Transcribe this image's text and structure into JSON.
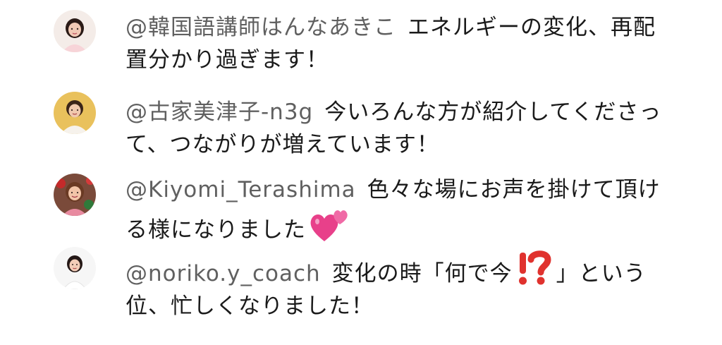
{
  "comments": [
    {
      "handle": "@韓国語講師はんなあきこ",
      "text": "エネルギーの変化、再配置分かり過ぎます！"
    },
    {
      "handle": "@古家美津子-n3g",
      "text": "今いろんな方が紹介してくださって、つながりが増えています！"
    },
    {
      "handle": "@Kiyomi_Terashima",
      "text": "色々な場にお声を掛けて頂ける様になりました",
      "emoji": "two-hearts-icon"
    },
    {
      "handle": "@noriko.y_coach",
      "text_before": "変化の時「何で今",
      "emoji": "exclamation-question-mark-icon",
      "text_after": "」という位、忙しくなりました！"
    }
  ],
  "colors": {
    "handle": "#606060",
    "text": "#1a1a1a",
    "background": "#ffffff",
    "heart": "#e8408a",
    "interrobang": "#e0322e"
  }
}
